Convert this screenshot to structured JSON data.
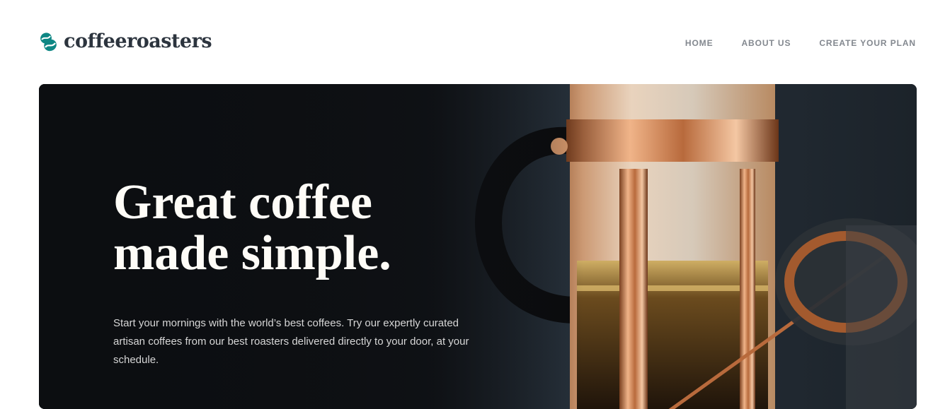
{
  "brand": {
    "name": "coffeeroasters",
    "accent": "#0e8784",
    "dark": "#2c343e"
  },
  "nav": {
    "items": [
      {
        "label": "HOME"
      },
      {
        "label": "ABOUT US"
      },
      {
        "label": "CREATE YOUR PLAN"
      }
    ]
  },
  "hero": {
    "title_line1": "Great coffee",
    "title_line2": "made simple.",
    "description": "Start your mornings with the world’s best coffees. Try our expertly curated artisan coffees from our best roasters delivered directly to your door, at your schedule.",
    "image_icon": "french-press-photo"
  }
}
